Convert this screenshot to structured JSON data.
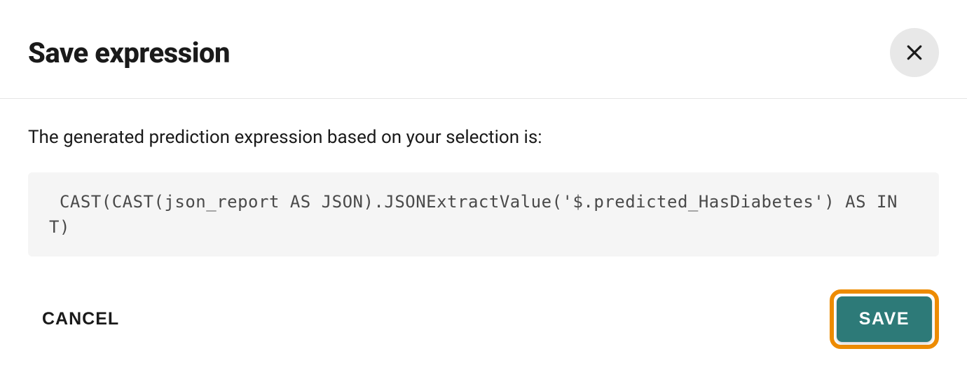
{
  "dialog": {
    "title": "Save expression",
    "description": "The generated prediction expression based on your selection is:",
    "code": " CAST(CAST(json_report AS JSON).JSONExtractValue('$.predicted_HasDiabetes') AS INT)",
    "cancel_label": "CANCEL",
    "save_label": "SAVE"
  }
}
